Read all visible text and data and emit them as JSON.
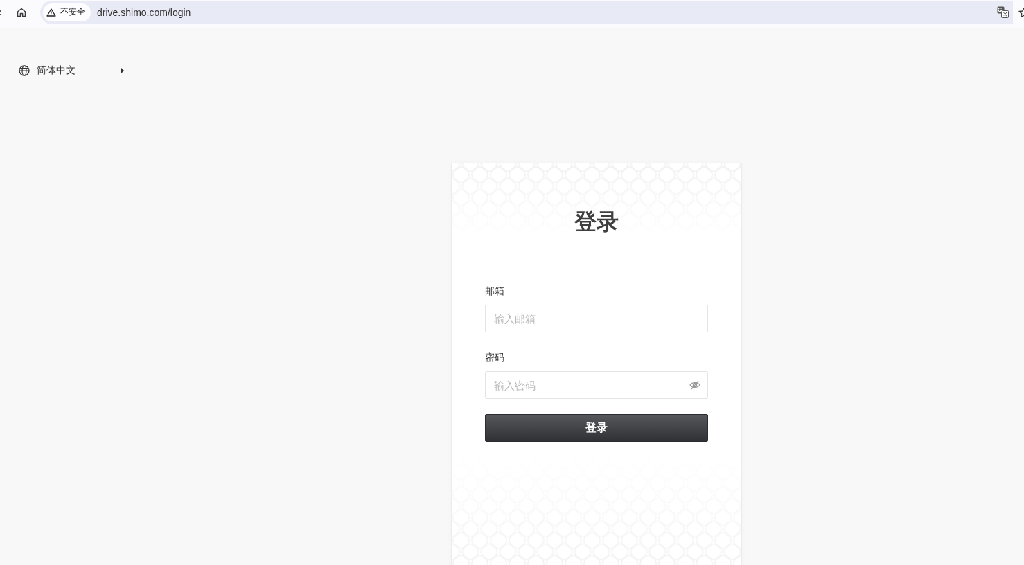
{
  "browser": {
    "security_label": "不安全",
    "url": "drive.shimo.com/login"
  },
  "language_selector": {
    "label": "简体中文"
  },
  "login_form": {
    "title": "登录",
    "fields": [
      {
        "kind": "text",
        "label": "邮箱",
        "placeholder": "输入邮箱"
      },
      {
        "kind": "password",
        "label": "密码",
        "placeholder": "输入密码"
      }
    ],
    "submit": "登录"
  }
}
